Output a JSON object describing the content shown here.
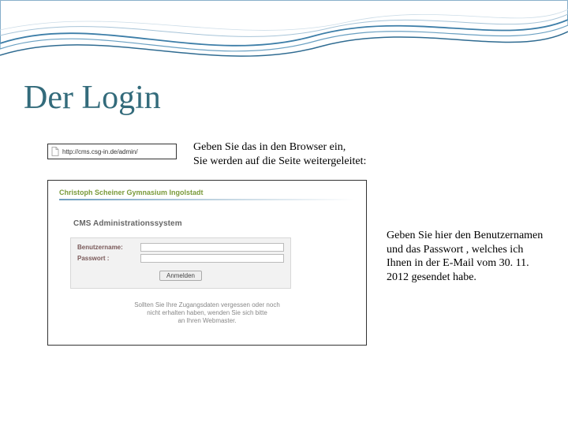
{
  "title": "Der Login",
  "urlbar": {
    "url": "http://cms.csg-in.de/admin/"
  },
  "instr1": {
    "line1": "Geben Sie das in den Browser ein,",
    "line2": "Sie werden auf die Seite weitergeleitet:"
  },
  "cms": {
    "header": "Christoph Scheiner Gymnasium Ingolstadt",
    "subtitle": "CMS Administrationssystem",
    "label_user": "Benutzername:",
    "label_pass": "Passwort :",
    "submit": "Anmelden",
    "footer_l1": "Sollten Sie Ihre Zugangsdaten vergessen oder noch",
    "footer_l2": "nicht erhalten haben, wenden Sie sich bitte",
    "footer_l3": "an Ihren Webmaster."
  },
  "instr2": "Geben Sie hier den Benutzernamen und das Passwort , welches ich Ihnen in der E-Mail vom 30. 11. 2012 gesendet habe."
}
